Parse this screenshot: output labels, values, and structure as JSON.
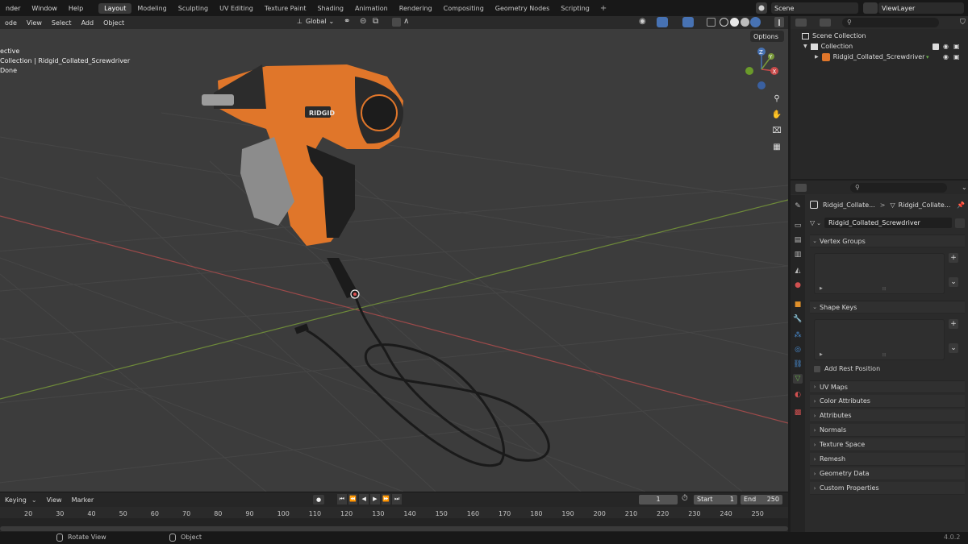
{
  "topbar": {
    "menus": [
      "nder",
      "Window",
      "Help"
    ],
    "workspaces": [
      "Layout",
      "Modeling",
      "Sculpting",
      "UV Editing",
      "Texture Paint",
      "Shading",
      "Animation",
      "Rendering",
      "Compositing",
      "Geometry Nodes",
      "Scripting"
    ],
    "active_workspace": "Layout",
    "plus": "+",
    "scene_label": "Scene",
    "viewlayer_label": "ViewLayer"
  },
  "viewport": {
    "mode_label": "ode",
    "menus": [
      "View",
      "Select",
      "Add",
      "Object"
    ],
    "orientation": "Global",
    "options_label": "Options",
    "overlay_lines": [
      "ective",
      "Collection | Ridgid_Collated_Screwdriver",
      "Done"
    ],
    "gizmo": {
      "x": "X",
      "y": "Y",
      "z": "Z"
    }
  },
  "timeline": {
    "keying_label": "Keying",
    "menus": [
      "View",
      "Marker"
    ],
    "current_frame": "1",
    "start_label": "Start",
    "start_value": "1",
    "end_label": "End",
    "end_value": "250",
    "frame_numbers": [
      "20",
      "30",
      "40",
      "50",
      "60",
      "70",
      "80",
      "90",
      "100",
      "110",
      "120",
      "130",
      "140",
      "150",
      "160",
      "170",
      "180",
      "190",
      "200",
      "210",
      "220",
      "230",
      "240",
      "250"
    ]
  },
  "statusbar": {
    "rotate_view": "Rotate View",
    "object": "Object",
    "version": "4.0.2"
  },
  "outliner": {
    "scene_collection": "Scene Collection",
    "collection": "Collection",
    "object_name": "Ridgid_Collated_Screwdriver"
  },
  "properties": {
    "breadcrumb_object": "Ridgid_Collate...",
    "breadcrumb_mesh": "Ridgid_Collate...",
    "mesh_name": "Ridgid_Collated_Screwdriver",
    "vertex_groups": "Vertex Groups",
    "shape_keys": "Shape Keys",
    "add_rest_position": "Add Rest Position",
    "sections": [
      "UV Maps",
      "Color Attributes",
      "Attributes",
      "Normals",
      "Texture Space",
      "Remesh",
      "Geometry Data",
      "Custom Properties"
    ]
  },
  "colors": {
    "accent": "#4772b3",
    "tool_orange": "#e0762a",
    "x_axis": "#c84a4a",
    "y_axis": "#7a9a3a"
  }
}
